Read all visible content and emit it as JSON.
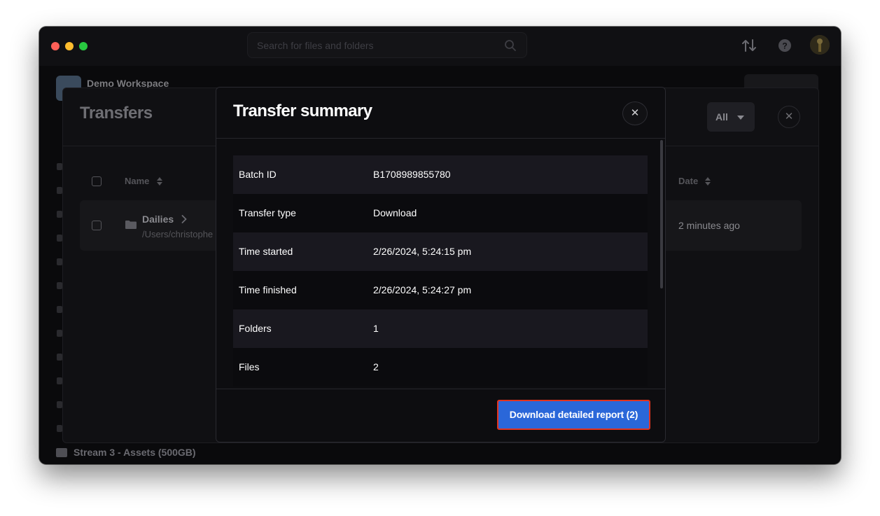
{
  "search": {
    "placeholder": "Search for files and folders"
  },
  "workspace": {
    "name": "Demo Workspace"
  },
  "sidebar": {
    "stream_label": "Stream 3 - Assets (500GB)"
  },
  "transfers": {
    "title": "Transfers",
    "filter": {
      "selected": "All"
    },
    "columns": {
      "name": "Name",
      "date": "Date"
    },
    "rows": [
      {
        "name": "Dailies",
        "path": "/Users/christophe",
        "date": "2 minutes ago"
      }
    ]
  },
  "modal": {
    "title": "Transfer summary",
    "rows": [
      {
        "key": "Batch ID",
        "value": "B1708989855780"
      },
      {
        "key": "Transfer type",
        "value": "Download"
      },
      {
        "key": "Time started",
        "value": "2/26/2024, 5:24:15 pm"
      },
      {
        "key": "Time finished",
        "value": "2/26/2024, 5:24:27 pm"
      },
      {
        "key": "Folders",
        "value": "1"
      },
      {
        "key": "Files",
        "value": "2"
      }
    ],
    "download_button": "Download detailed report (2)"
  },
  "colors": {
    "accent": "#2a67d9",
    "highlight_border": "#e2331e",
    "modal_bg": "#0d0d10",
    "row_alt": "#19181f"
  },
  "icons": [
    "search-icon",
    "transfer-arrows-icon",
    "help-icon",
    "avatar",
    "folder-icon",
    "chevron-right-icon",
    "close-icon",
    "sort-icon",
    "caret-down-icon"
  ]
}
